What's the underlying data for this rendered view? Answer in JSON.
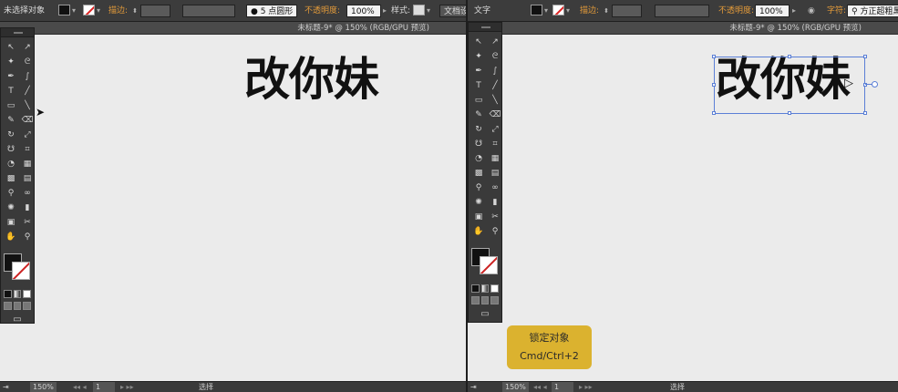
{
  "left": {
    "control_bar": {
      "selection_label": "未选择对象",
      "stroke_label": "描边:",
      "brush_label": "5 点圆形",
      "opacity_label": "不透明度:",
      "opacity_value": "100%",
      "style_label": "样式:",
      "doc_button": "文档设"
    },
    "doc_title": "未标题-9* @ 150% (RGB/GPU 预览)",
    "canvas_text": "改你妹",
    "status": {
      "zoom": "150%",
      "page": "1",
      "tool": "选择"
    }
  },
  "right": {
    "control_bar": {
      "selection_label": "文字",
      "stroke_label": "描边:",
      "opacity_label": "不透明度:",
      "opacity_value": "100%",
      "char_label": "字符:",
      "font_value": "方正超粗黑"
    },
    "doc_title": "未标题-9* @ 150% (RGB/GPU 预览)",
    "canvas_text": "改你妹",
    "tooltip": {
      "line1": "锁定对象",
      "line2": "Cmd/Ctrl+2"
    },
    "status": {
      "zoom": "150%",
      "page": "1",
      "tool": "选择"
    }
  },
  "tools": [
    {
      "name": "selection-tool-icon",
      "glyph": "↖"
    },
    {
      "name": "direct-selection-tool-icon",
      "glyph": "↗"
    },
    {
      "name": "magic-wand-tool-icon",
      "glyph": "✦"
    },
    {
      "name": "lasso-tool-icon",
      "glyph": "ᘓ"
    },
    {
      "name": "pen-tool-icon",
      "glyph": "✒"
    },
    {
      "name": "curvature-tool-icon",
      "glyph": "∫"
    },
    {
      "name": "type-tool-icon",
      "glyph": "T"
    },
    {
      "name": "line-tool-icon",
      "glyph": "╱"
    },
    {
      "name": "rectangle-tool-icon",
      "glyph": "▭"
    },
    {
      "name": "paintbrush-tool-icon",
      "glyph": "╲"
    },
    {
      "name": "pencil-tool-icon",
      "glyph": "✎"
    },
    {
      "name": "eraser-tool-icon",
      "glyph": "⌫"
    },
    {
      "name": "rotate-tool-icon",
      "glyph": "↻"
    },
    {
      "name": "scale-tool-icon",
      "glyph": "⤢"
    },
    {
      "name": "warp-tool-icon",
      "glyph": "☋"
    },
    {
      "name": "free-transform-tool-icon",
      "glyph": "⌗"
    },
    {
      "name": "shape-builder-tool-icon",
      "glyph": "◔"
    },
    {
      "name": "perspective-grid-tool-icon",
      "glyph": "▦"
    },
    {
      "name": "mesh-tool-icon",
      "glyph": "▩"
    },
    {
      "name": "gradient-tool-icon",
      "glyph": "▤"
    },
    {
      "name": "eyedropper-tool-icon",
      "glyph": "⚲"
    },
    {
      "name": "blend-tool-icon",
      "glyph": "∞"
    },
    {
      "name": "symbol-sprayer-tool-icon",
      "glyph": "✺"
    },
    {
      "name": "column-graph-tool-icon",
      "glyph": "▮"
    },
    {
      "name": "artboard-tool-icon",
      "glyph": "▣"
    },
    {
      "name": "slice-tool-icon",
      "glyph": "✂"
    },
    {
      "name": "hand-tool-icon",
      "glyph": "✋"
    },
    {
      "name": "zoom-tool-icon",
      "glyph": "⚲"
    }
  ]
}
